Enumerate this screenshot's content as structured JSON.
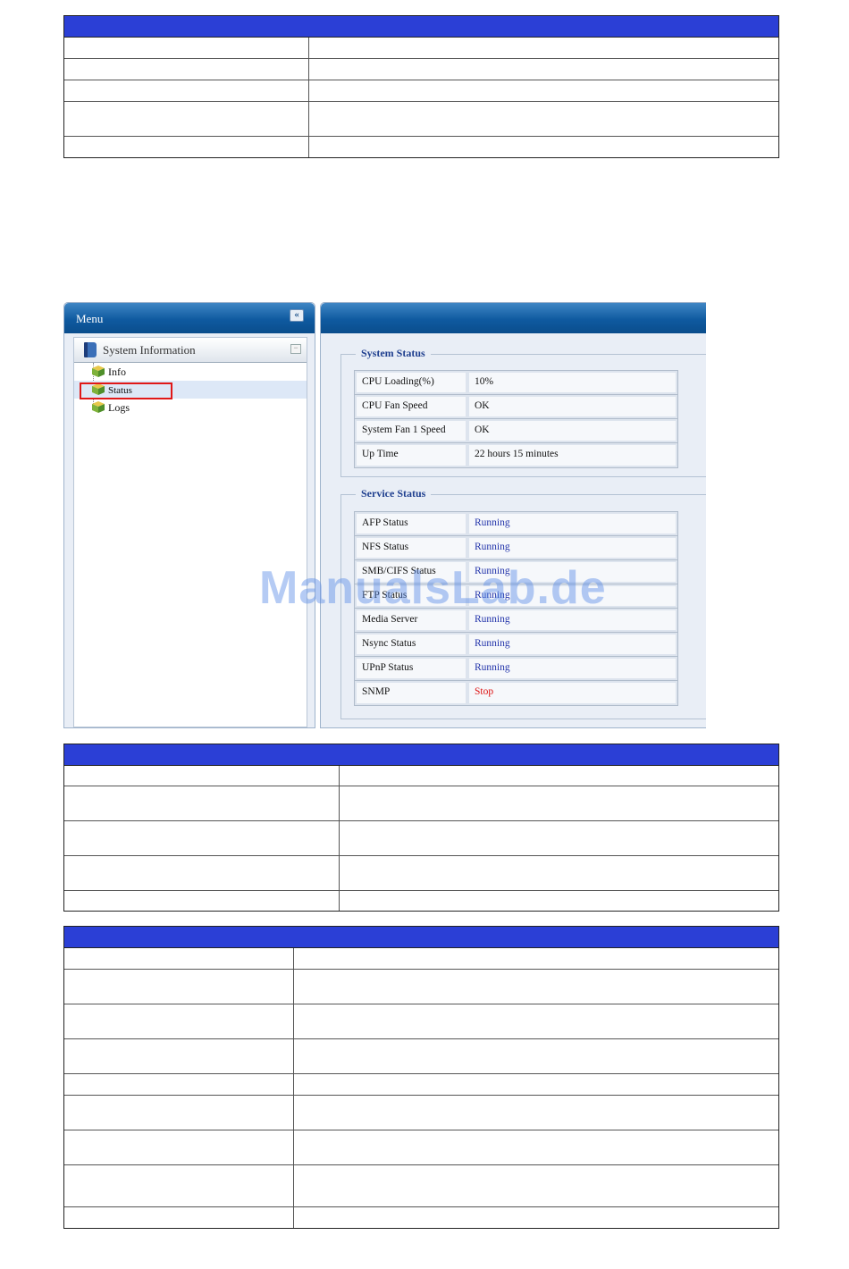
{
  "colors": {
    "table_header": "#2b3fd6",
    "panel_header": "#0f5aa0",
    "highlight": "#e01818",
    "running": "#2233aa",
    "stop": "#dd1111"
  },
  "menu": {
    "title": "Menu",
    "collapse_glyph": "«",
    "group": "System Information",
    "minimize_glyph": "−",
    "items": [
      {
        "label": "Info",
        "icon": "cube-icon"
      },
      {
        "label": "Status",
        "icon": "cube-icon",
        "selected": true
      },
      {
        "label": "Logs",
        "icon": "cube-icon"
      }
    ]
  },
  "system_status": {
    "legend": "System Status",
    "rows": [
      {
        "key": "CPU Loading(%)",
        "value": "10%"
      },
      {
        "key": "CPU Fan Speed",
        "value": "OK"
      },
      {
        "key": "System Fan 1 Speed",
        "value": "OK"
      },
      {
        "key": "Up Time",
        "value": "22 hours 15 minutes"
      }
    ]
  },
  "service_status": {
    "legend": "Service Status",
    "rows": [
      {
        "key": "AFP Status",
        "value": "Running",
        "state": "running"
      },
      {
        "key": "NFS Status",
        "value": "Running",
        "state": "running"
      },
      {
        "key": "SMB/CIFS Status",
        "value": "Running",
        "state": "running"
      },
      {
        "key": "FTP Status",
        "value": "Running",
        "state": "running"
      },
      {
        "key": "Media Server",
        "value": "Running",
        "state": "running"
      },
      {
        "key": "Nsync Status",
        "value": "Running",
        "state": "running"
      },
      {
        "key": "UPnP Status",
        "value": "Running",
        "state": "running"
      },
      {
        "key": "SNMP",
        "value": "Stop",
        "state": "stop"
      }
    ]
  },
  "watermark": "ManualsLab.de"
}
